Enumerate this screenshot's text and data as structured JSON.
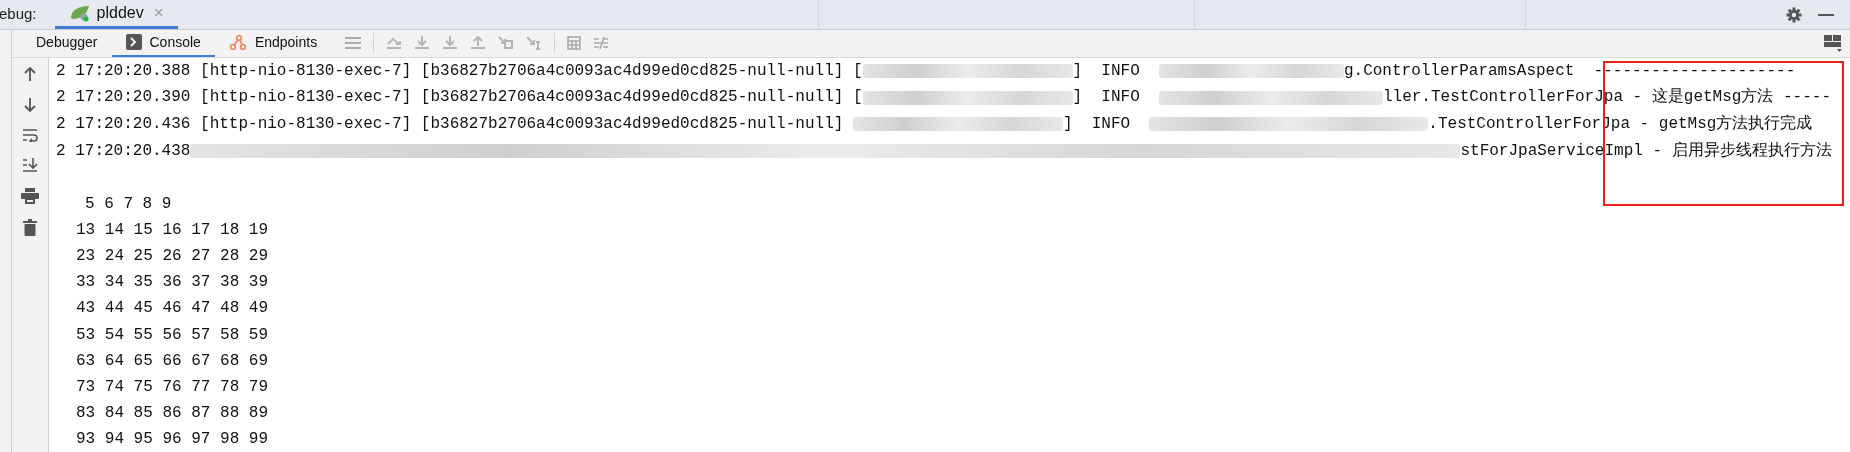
{
  "header": {
    "label": "ebug:",
    "tab": {
      "title": "plddev",
      "close": "×",
      "selected": true
    }
  },
  "tool_tabs": [
    {
      "label": "Debugger",
      "selected": false
    },
    {
      "label": "Console",
      "selected": true
    },
    {
      "label": "Endpoints",
      "selected": false
    }
  ],
  "console": {
    "log_lines": [
      {
        "segments": [
          {
            "kind": "text",
            "text": "2 17:20:20.388 [http-nio-8130-exec-7] [b36827b2706a4c0093ac4d99ed0cd825-null-null] ["
          },
          {
            "kind": "redacted"
          },
          {
            "kind": "text",
            "text": "]  INFO  "
          },
          {
            "kind": "redacted"
          },
          {
            "kind": "text",
            "text": "g.ControllerParamsAspect  ---------------------"
          }
        ]
      },
      {
        "segments": [
          {
            "kind": "text",
            "text": "2 17:20:20.390 [http-nio-8130-exec-7] [b36827b2706a4c0093ac4d99ed0cd825-null-null] ["
          },
          {
            "kind": "redacted"
          },
          {
            "kind": "text",
            "text": "]  INFO  "
          },
          {
            "kind": "redacted"
          },
          {
            "kind": "text",
            "text": "ller.TestControllerForJpa - 这是getMsg方法 -----"
          }
        ]
      },
      {
        "segments": [
          {
            "kind": "text",
            "text": "2 17:20:20.436 [http-nio-8130-exec-7] [b36827b2706a4c0093ac4d99ed0cd825-null-null] "
          },
          {
            "kind": "redacted"
          },
          {
            "kind": "text",
            "text": "]  INFO  "
          },
          {
            "kind": "redacted"
          },
          {
            "kind": "text",
            "text": ".TestControllerForJpa - getMsg方法执行完成"
          }
        ]
      },
      {
        "segments": [
          {
            "kind": "text",
            "text": "2 17:20:20.438"
          },
          {
            "kind": "redacted"
          },
          {
            "kind": "text",
            "text": "stForJpaServiceImpl - 启用异步线程执行方法"
          }
        ]
      }
    ],
    "number_rows": [
      "5 6 7 8 9",
      "13 14 15 16 17 18 19",
      "23 24 25 26 27 28 29",
      "33 34 35 36 37 38 39",
      "43 44 45 46 47 48 49",
      "53 54 55 56 57 58 59",
      "63 64 65 66 67 68 69",
      "73 74 75 76 77 78 79",
      "83 84 85 86 87 88 89",
      "93 94 95 96 97 98 99"
    ]
  },
  "annotation": {
    "kind": "highlight-box"
  }
}
